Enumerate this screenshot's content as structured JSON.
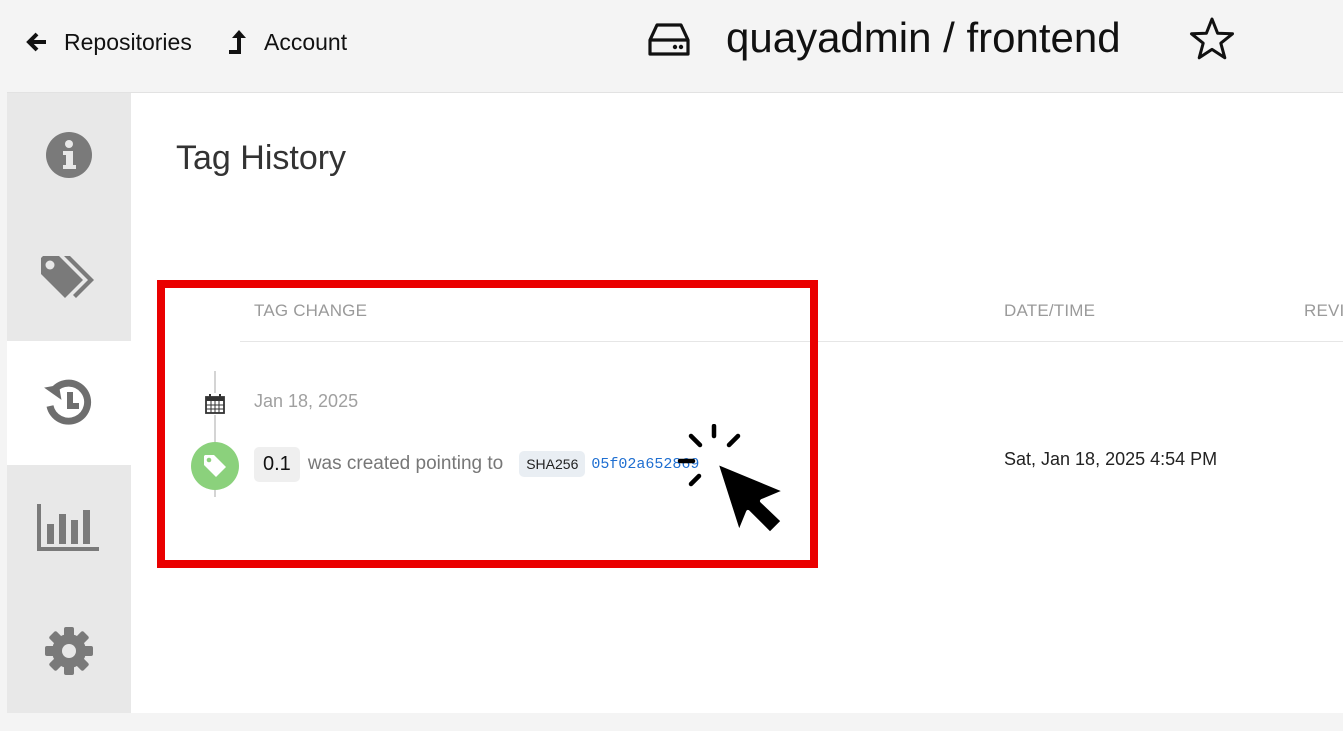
{
  "nav": {
    "back_label": "Repositories",
    "account_label": "Account"
  },
  "repo": {
    "title": "quayadmin / frontend",
    "icon": "hard-drive-icon",
    "star_icon": "star-outline-icon"
  },
  "sidebar": {
    "items": [
      {
        "name": "information",
        "icon": "info-circle-icon",
        "active": false
      },
      {
        "name": "tags",
        "icon": "tags-icon",
        "active": false
      },
      {
        "name": "tag-history",
        "icon": "history-icon",
        "active": true
      },
      {
        "name": "usage-logs",
        "icon": "bar-chart-icon",
        "active": false
      },
      {
        "name": "settings",
        "icon": "gear-icon",
        "active": false
      }
    ]
  },
  "page": {
    "title": "Tag History"
  },
  "table": {
    "headers": {
      "tag_change": "TAG CHANGE",
      "datetime": "DATE/TIME",
      "revert": "REVI"
    },
    "date_group": "Jan 18, 2025",
    "entry": {
      "tag": "0.1",
      "action_text": "was created pointing to",
      "digest_type": "SHA256",
      "digest_short": "05f02a652869",
      "datetime": "Sat, Jan 18, 2025 4:54 PM"
    }
  },
  "colors": {
    "highlight": "#ea0000",
    "tag_dot": "#8bd17c",
    "link": "#1f6fd1",
    "sidebar_bg": "#e8e8e8"
  }
}
